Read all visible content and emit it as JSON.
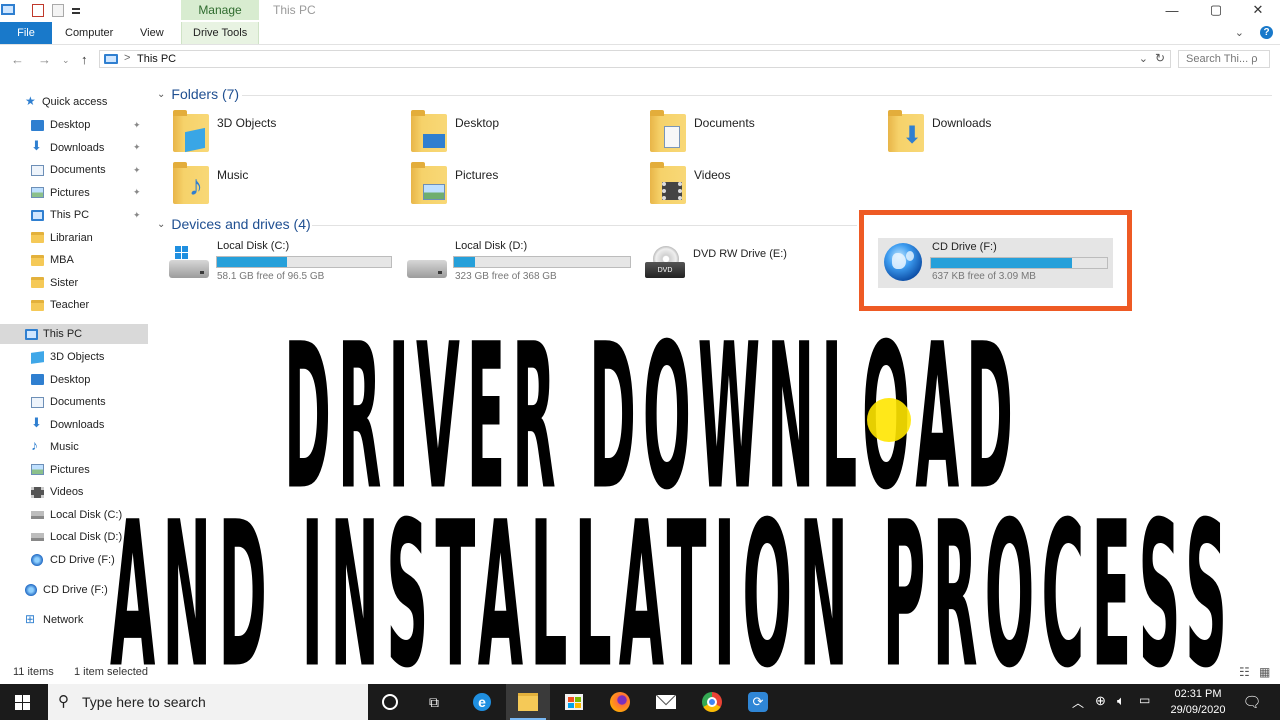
{
  "window": {
    "title": "This PC",
    "ribbon_context_tab": "Manage",
    "tabs": [
      "File",
      "Computer",
      "View",
      "Drive Tools"
    ],
    "buttons": {
      "minimize": "—",
      "maximize": "▢",
      "close": "✕",
      "help": "?"
    }
  },
  "navigation": {
    "back": "←",
    "forward": "→",
    "up": "↑",
    "address_separator": ">",
    "address": "This PC",
    "refresh": "↻",
    "search_placeholder": "Search Thi... ρ"
  },
  "sidebar": {
    "quick_access_label": "Quick access",
    "quick_access": [
      {
        "label": "Desktop",
        "icon": "desktop-icon",
        "pinned": true
      },
      {
        "label": "Downloads",
        "icon": "downloads-icon",
        "pinned": true
      },
      {
        "label": "Documents",
        "icon": "documents-icon",
        "pinned": true
      },
      {
        "label": "Pictures",
        "icon": "pictures-icon",
        "pinned": true
      },
      {
        "label": "This PC",
        "icon": "this-pc-icon",
        "pinned": true
      },
      {
        "label": "Librarian",
        "icon": "folder-icon",
        "pinned": false
      },
      {
        "label": "MBA",
        "icon": "folder-icon",
        "pinned": false
      },
      {
        "label": "Sister",
        "icon": "folder-icon",
        "pinned": false
      },
      {
        "label": "Teacher",
        "icon": "folder-icon",
        "pinned": false
      }
    ],
    "this_pc_label": "This PC",
    "this_pc_children": [
      {
        "label": "3D Objects",
        "icon": "3d-objects-icon"
      },
      {
        "label": "Desktop",
        "icon": "desktop-icon"
      },
      {
        "label": "Documents",
        "icon": "documents-icon"
      },
      {
        "label": "Downloads",
        "icon": "downloads-icon"
      },
      {
        "label": "Music",
        "icon": "music-icon"
      },
      {
        "label": "Pictures",
        "icon": "pictures-icon"
      },
      {
        "label": "Videos",
        "icon": "videos-icon"
      },
      {
        "label": "Local Disk (C:)",
        "icon": "disk-icon"
      },
      {
        "label": "Local Disk (D:)",
        "icon": "disk-icon"
      },
      {
        "label": "CD Drive (F:)",
        "icon": "cd-drive-icon"
      }
    ],
    "cd_drive_label": "CD Drive (F:)",
    "network_label": "Network"
  },
  "content": {
    "folders_header": "Folders (7)",
    "folders": [
      {
        "name": "3D Objects",
        "icon": "3d-objects-folder-icon"
      },
      {
        "name": "Desktop",
        "icon": "desktop-folder-icon"
      },
      {
        "name": "Documents",
        "icon": "documents-folder-icon"
      },
      {
        "name": "Downloads",
        "icon": "downloads-folder-icon"
      },
      {
        "name": "Music",
        "icon": "music-folder-icon"
      },
      {
        "name": "Pictures",
        "icon": "pictures-folder-icon"
      },
      {
        "name": "Videos",
        "icon": "videos-folder-icon"
      }
    ],
    "drives_header": "Devices and drives (4)",
    "drives": [
      {
        "name": "Local Disk (C:)",
        "free": "58.1 GB free of 96.5 GB",
        "used_fraction": 0.4,
        "icon": "windows-disk-icon"
      },
      {
        "name": "Local Disk (D:)",
        "free": "323 GB free of 368 GB",
        "used_fraction": 0.12,
        "icon": "hard-disk-icon"
      },
      {
        "name": "DVD RW Drive (E:)",
        "icon": "dvd-drive-icon"
      },
      {
        "name": "CD Drive (F:)",
        "free": "637 KB free of 3.09 MB",
        "used_fraction": 0.8,
        "icon": "cd-drive-globe-icon",
        "selected": true
      }
    ]
  },
  "overlay": {
    "line1": "DRIVER DOWNLOAD",
    "line2": "AND INSTALLATION PROCESS"
  },
  "status": {
    "items": "11 items",
    "selected": "1 item selected"
  },
  "taskbar": {
    "search_placeholder": "Type here to search",
    "time": "02:31 PM",
    "date": "29/09/2020"
  },
  "colors": {
    "accent": "#1979ca",
    "highlight": "#ee5a24",
    "progress": "#26a0da",
    "section_header": "#1f4f91"
  }
}
